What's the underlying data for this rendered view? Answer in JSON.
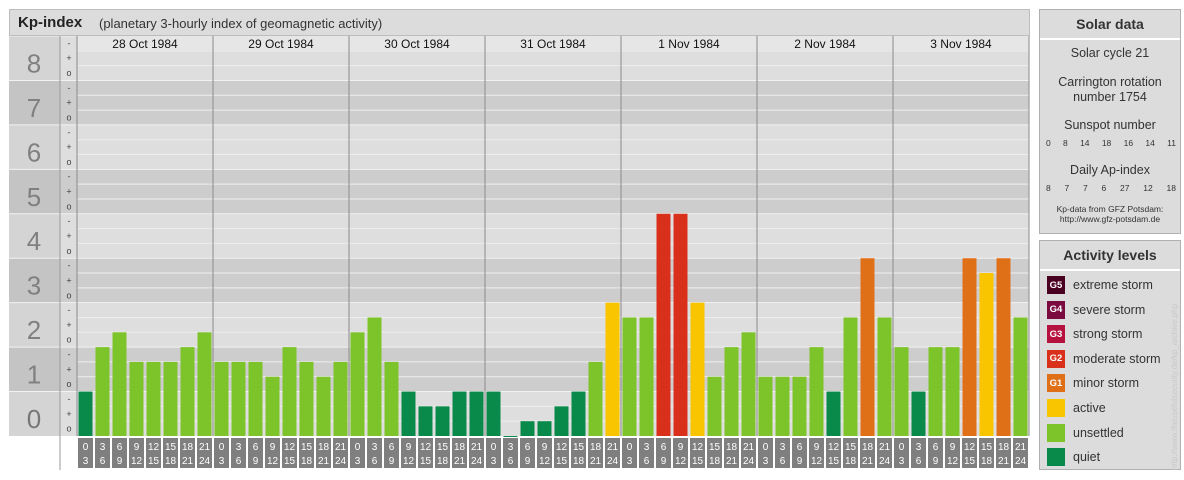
{
  "title": "Kp-index",
  "subtitle": "(planetary 3-hourly index of geomagnetic activity)",
  "chart_data": {
    "type": "bar",
    "title": "Kp-index",
    "subtitle": "(planetary 3-hourly index of geomagnetic activity)",
    "ylim": [
      0,
      9
    ],
    "y_major_ticks": [
      "0",
      "1",
      "2",
      "3",
      "4",
      "5",
      "6",
      "7",
      "8",
      "9"
    ],
    "y_minor_ticks": [
      "o",
      "+",
      "-"
    ],
    "days": [
      "28 Oct 1984",
      "29 Oct 1984",
      "30 Oct 1984",
      "31 Oct 1984",
      "1 Nov 1984",
      "2 Nov 1984",
      "3 Nov 1984"
    ],
    "interval_start_hours": [
      "0",
      "3",
      "6",
      "9",
      "12",
      "15",
      "18",
      "21"
    ],
    "interval_end_hours": [
      "3",
      "6",
      "9",
      "12",
      "15",
      "18",
      "21",
      "24"
    ],
    "values": [
      1.0,
      2.0,
      2.333,
      1.667,
      1.667,
      1.667,
      2.0,
      2.333,
      1.667,
      1.667,
      1.667,
      1.333,
      2.0,
      1.667,
      1.333,
      1.667,
      2.333,
      2.667,
      1.667,
      1.0,
      0.667,
      0.667,
      1.0,
      1.0,
      1.0,
      0.0,
      0.333,
      0.333,
      0.667,
      1.0,
      1.667,
      3.0,
      2.667,
      2.667,
      5.0,
      5.0,
      3.0,
      1.333,
      2.0,
      2.333,
      1.333,
      1.333,
      1.333,
      2.0,
      1.0,
      2.667,
      4.0,
      2.667,
      2.0,
      1.0,
      2.0,
      2.0,
      4.0,
      3.667,
      4.0,
      2.667
    ],
    "grid": true,
    "level_colors": {
      "quiet": "#0a8a4a",
      "unsettled": "#7dc42b",
      "active": "#f9c400",
      "G1": "#e07018",
      "G2": "#d9301c",
      "G3": "#b5123f",
      "G4": "#7a0a3f",
      "G5": "#4a0020"
    }
  },
  "solar": {
    "title": "Solar data",
    "cycle": "Solar cycle 21",
    "carrington_line1": "Carrington rotation",
    "carrington_line2": "number 1754",
    "sunspot_label": "Sunspot number",
    "sunspot_values": [
      "0",
      "8",
      "14",
      "18",
      "16",
      "14",
      "11"
    ],
    "ap_label": "Daily Ap-index",
    "ap_values": [
      "8",
      "7",
      "7",
      "6",
      "27",
      "12",
      "18"
    ],
    "credit_line1": "Kp-data from GFZ Potsdam:",
    "credit_line2": "http://www.gfz-potsdam.de"
  },
  "activity": {
    "title": "Activity levels",
    "levels": [
      {
        "code": "G5",
        "label": "extreme storm",
        "color": "#4a0020"
      },
      {
        "code": "G4",
        "label": "severe storm",
        "color": "#7a0a3f"
      },
      {
        "code": "G3",
        "label": "strong storm",
        "color": "#b5123f"
      },
      {
        "code": "G2",
        "label": "moderate storm",
        "color": "#d9301c"
      },
      {
        "code": "G1",
        "label": "minor storm",
        "color": "#e07018"
      },
      {
        "code": "",
        "label": "active",
        "color": "#f9c400"
      },
      {
        "code": "",
        "label": "unsettled",
        "color": "#7dc42b"
      },
      {
        "code": "",
        "label": "quiet",
        "color": "#0a8a4a"
      }
    ]
  },
  "side_credit": "http://www.theusefulsecurity.de/kp_archive.php"
}
